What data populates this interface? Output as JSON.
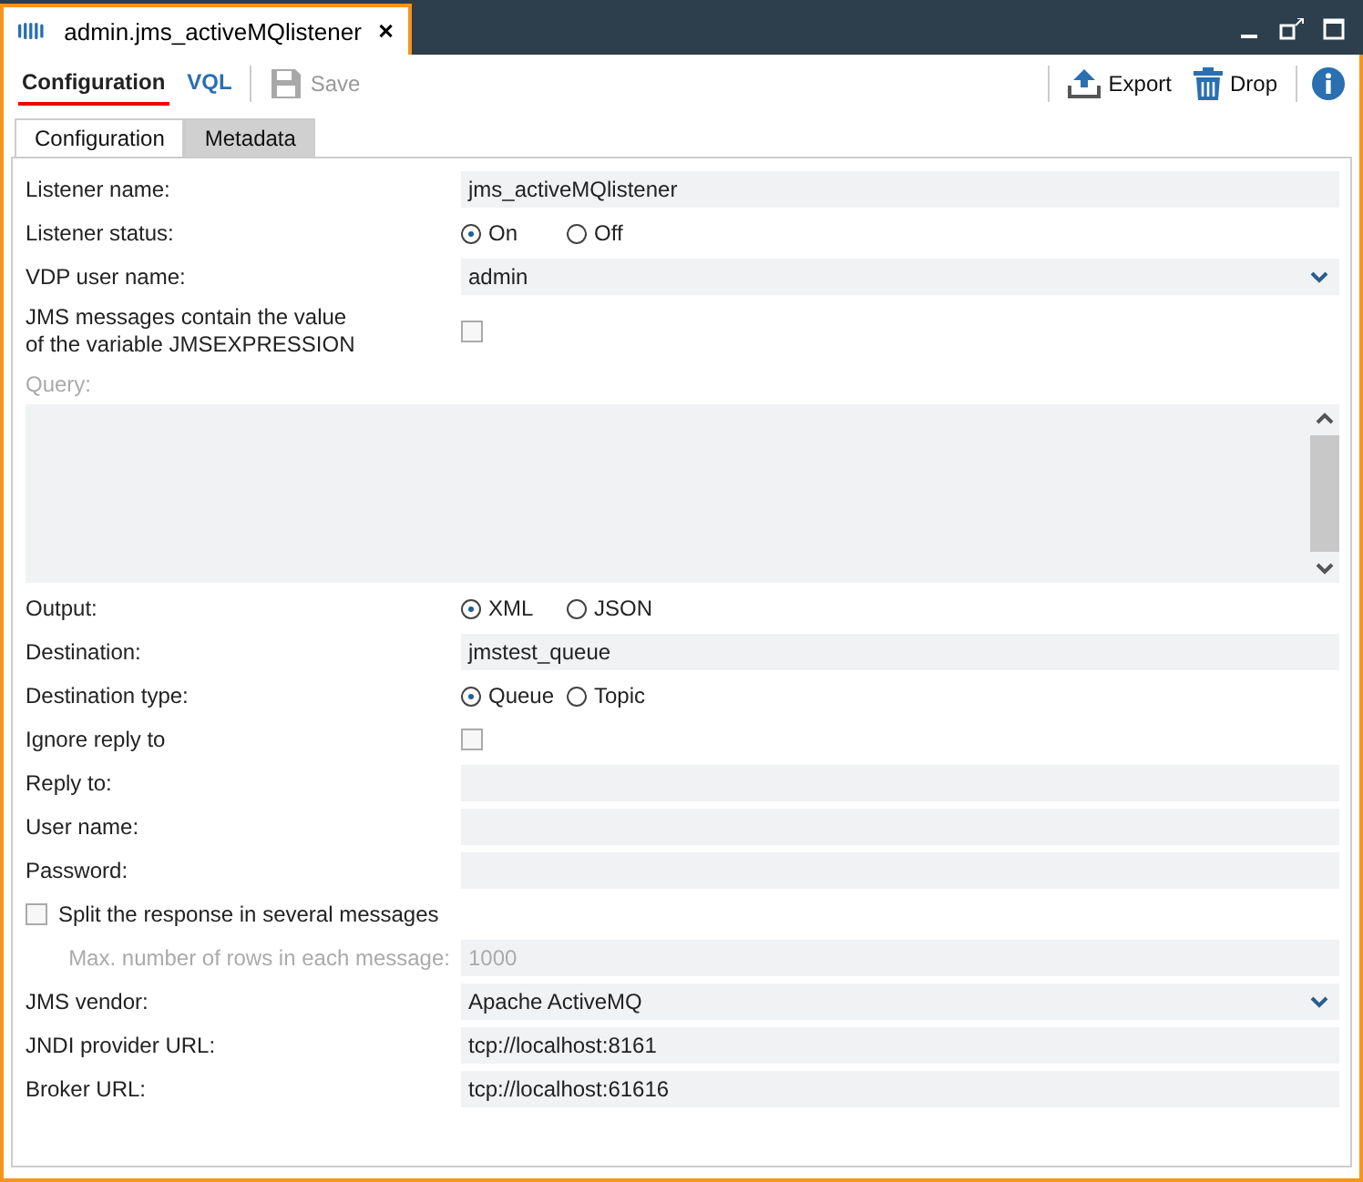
{
  "window": {
    "tab_title": "admin.jms_activeMQlistener"
  },
  "view_tabs": [
    {
      "label": "Configuration",
      "selected": true
    },
    {
      "label": "VQL",
      "selected": false
    }
  ],
  "toolbar": {
    "save": {
      "label": "Save",
      "disabled": true
    },
    "export": "Export",
    "drop": "Drop"
  },
  "tabs": [
    {
      "label": "Configuration",
      "selected": true
    },
    {
      "label": "Metadata",
      "selected": false
    }
  ],
  "rows": [
    {
      "kind": "text",
      "label": "Listener name:",
      "value": "jms_activeMQlistener"
    },
    {
      "kind": "radio",
      "label": "Listener status:",
      "options": [
        {
          "label": "On",
          "selected": true
        },
        {
          "label": "Off",
          "selected": false
        }
      ]
    },
    {
      "kind": "select",
      "label": "VDP user name:",
      "value": "admin"
    },
    {
      "kind": "checkbox",
      "label": "JMS messages contain the value\nof the variable JMSEXPRESSION",
      "checked": false
    },
    {
      "kind": "textarea",
      "label": "Query:",
      "disabled": true
    },
    {
      "kind": "radio",
      "label": "Output:",
      "options": [
        {
          "label": "XML",
          "selected": true
        },
        {
          "label": "JSON",
          "selected": false
        }
      ]
    },
    {
      "kind": "text",
      "label": "Destination:",
      "value": "jmstest_queue"
    },
    {
      "kind": "radio",
      "label": "Destination type:",
      "options": [
        {
          "label": "Queue",
          "selected": true
        },
        {
          "label": "Topic",
          "selected": false
        }
      ]
    },
    {
      "kind": "checkbox",
      "label": "Ignore reply to",
      "checked": false
    },
    {
      "kind": "text",
      "label": "Reply to:"
    },
    {
      "kind": "text",
      "label": "User name:"
    },
    {
      "kind": "text",
      "label": "Password:"
    },
    {
      "kind": "leftcheck",
      "label": "Split the response in several messages",
      "checked": false
    },
    {
      "kind": "text",
      "label": "Max. number of rows in each message:",
      "value": "1000",
      "disabled": true
    },
    {
      "kind": "select",
      "label": "JMS vendor:",
      "value": "Apache ActiveMQ"
    },
    {
      "kind": "text",
      "label": "JNDI provider URL:",
      "value": "tcp://localhost:8161"
    },
    {
      "kind": "text",
      "label": "Broker URL:",
      "value": "tcp://localhost:61616"
    }
  ]
}
